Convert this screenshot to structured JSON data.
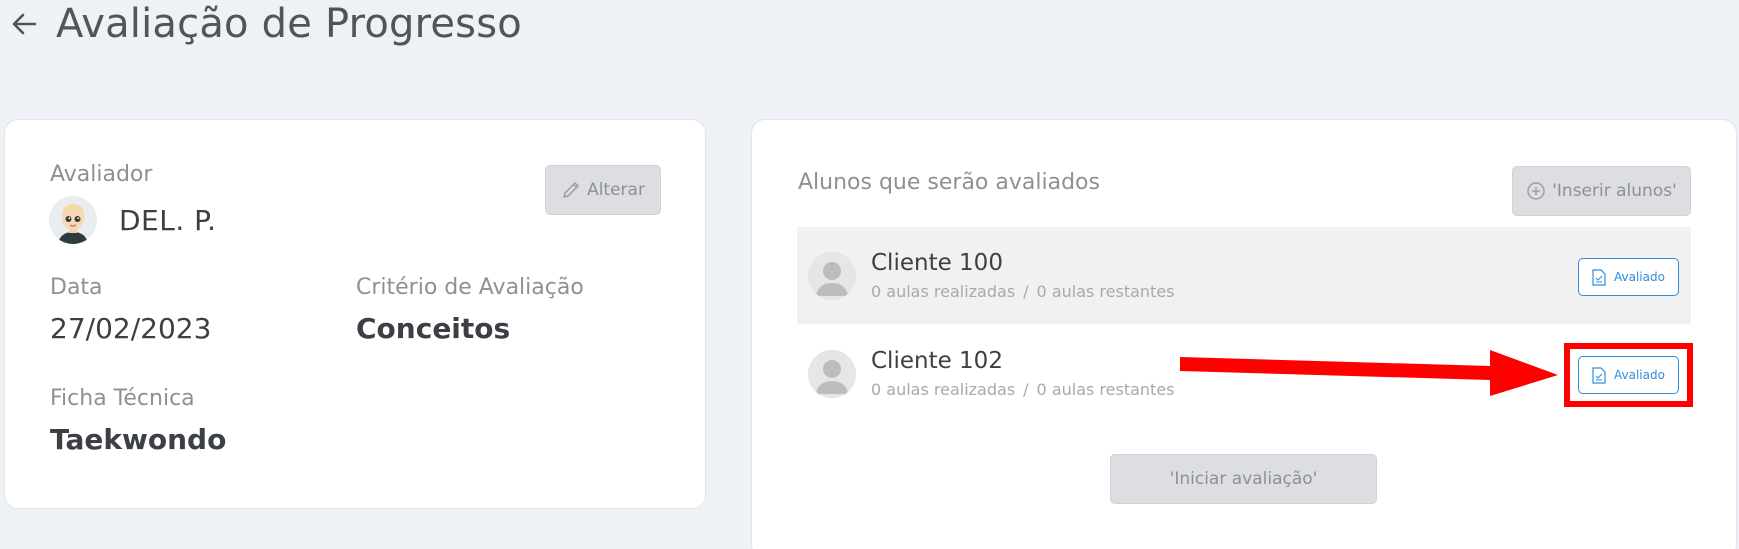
{
  "header": {
    "back_icon": "arrow-left-icon",
    "title": "Avaliação de Progresso"
  },
  "details": {
    "evaluator_label": "Avaliador",
    "evaluator_name": "DEL. P.",
    "alterar_label": "Alterar",
    "data_label": "Data",
    "data_value": "27/02/2023",
    "criterio_label": "Critério de Avaliação",
    "criterio_value": "Conceitos",
    "ficha_label": "Ficha Técnica",
    "ficha_value": "Taekwondo"
  },
  "students": {
    "title": "Alunos que serão avaliados",
    "inserir_label": "'Inserir alunos'",
    "iniciar_label": "'Iniciar avaliação'",
    "items": [
      {
        "name": "Cliente 100",
        "aulas_realizadas": "0 aulas realizadas",
        "aulas_restantes": "0 aulas restantes",
        "status_label": "Avaliado"
      },
      {
        "name": "Cliente 102",
        "aulas_realizadas": "0 aulas realizadas",
        "aulas_restantes": "0 aulas restantes",
        "status_label": "Avaliado"
      }
    ],
    "separator": "/"
  },
  "colors": {
    "background": "#eef1f6",
    "accent_blue": "#2f8ddd",
    "annotation_red": "#ff0000",
    "disabled_button": "#dcdee2"
  }
}
